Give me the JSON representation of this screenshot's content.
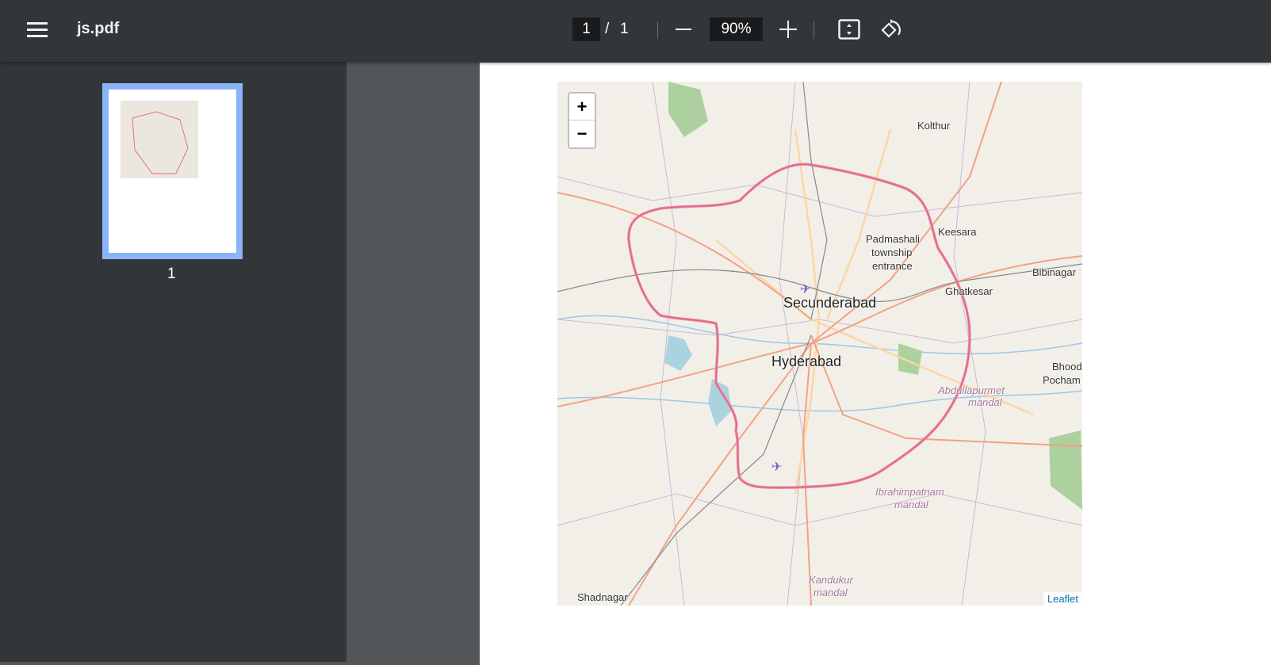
{
  "toolbar": {
    "title": "js.pdf",
    "current_page": "1",
    "page_separator": "/",
    "total_pages": "1",
    "zoom": "90%"
  },
  "sidebar": {
    "thumbnails": [
      {
        "label": "1"
      }
    ]
  },
  "map": {
    "zoom_in": "+",
    "zoom_out": "−",
    "attribution": "Leaflet",
    "labels": {
      "kolthur": "Kolthur",
      "keesara": "Keesara",
      "padmashali": "Padmashali",
      "township": "township",
      "entrance": "entrance",
      "bibinagar": "Bibinagar",
      "ghatkesar": "Ghatkesar",
      "secunderabad": "Secunderabad",
      "hyderabad": "Hyderabad",
      "bhoo": "Bhood",
      "pocham": "Pocham",
      "abdullapurmet": "Abdullapurmet",
      "mandal": "mandal",
      "ibrahimpatnam": "Ibrahimpatnam",
      "kandukur": "Kandukur",
      "shadnagar": "Shadnagar"
    }
  }
}
